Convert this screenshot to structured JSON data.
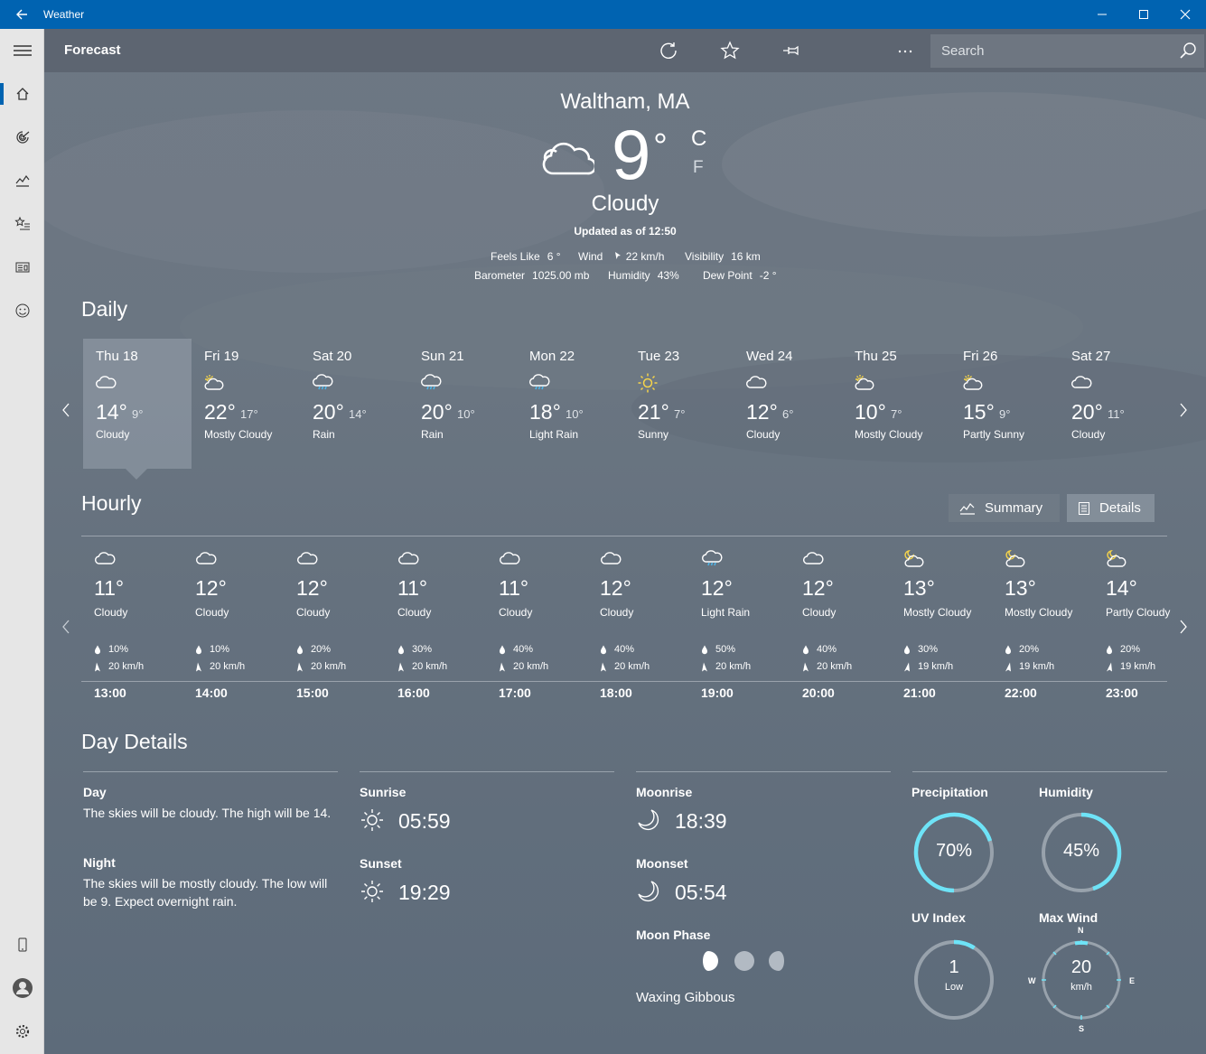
{
  "app": {
    "title": "Weather"
  },
  "header": {
    "title": "Forecast",
    "search_placeholder": "Search"
  },
  "current": {
    "location": "Waltham, MA",
    "temp": "9",
    "unit_c": "C",
    "unit_f": "F",
    "condition": "Cloudy",
    "updated": "Updated as of 12:50",
    "stats": {
      "feels_like_label": "Feels Like",
      "feels_like": "6 °",
      "wind_label": "Wind",
      "wind": "22 km/h",
      "visibility_label": "Visibility",
      "visibility": "16 km",
      "barometer_label": "Barometer",
      "barometer": "1025.00 mb",
      "humidity_label": "Humidity",
      "humidity": "43%",
      "dew_point_label": "Dew Point",
      "dew_point": "-2 °"
    }
  },
  "daily": {
    "title": "Daily",
    "days": [
      {
        "name": "Thu 18",
        "hi": "14°",
        "lo": "9°",
        "cond": "Cloudy",
        "icon": "cloud"
      },
      {
        "name": "Fri 19",
        "hi": "22°",
        "lo": "17°",
        "cond": "Mostly Cloudy",
        "icon": "sun-cloud"
      },
      {
        "name": "Sat 20",
        "hi": "20°",
        "lo": "14°",
        "cond": "Rain",
        "icon": "rain"
      },
      {
        "name": "Sun 21",
        "hi": "20°",
        "lo": "10°",
        "cond": "Rain",
        "icon": "rain"
      },
      {
        "name": "Mon 22",
        "hi": "18°",
        "lo": "10°",
        "cond": "Light Rain",
        "icon": "rain"
      },
      {
        "name": "Tue 23",
        "hi": "21°",
        "lo": "7°",
        "cond": "Sunny",
        "icon": "sun"
      },
      {
        "name": "Wed 24",
        "hi": "12°",
        "lo": "6°",
        "cond": "Cloudy",
        "icon": "cloud"
      },
      {
        "name": "Thu 25",
        "hi": "10°",
        "lo": "7°",
        "cond": "Mostly Cloudy",
        "icon": "sun-cloud"
      },
      {
        "name": "Fri 26",
        "hi": "15°",
        "lo": "9°",
        "cond": "Partly Sunny",
        "icon": "sun-cloud"
      },
      {
        "name": "Sat 27",
        "hi": "20°",
        "lo": "11°",
        "cond": "Cloudy",
        "icon": "cloud"
      }
    ]
  },
  "hourly": {
    "title": "Hourly",
    "summary_label": "Summary",
    "details_label": "Details",
    "hours": [
      {
        "time": "13:00",
        "temp": "11°",
        "cond": "Cloudy",
        "precip": "10%",
        "wind": "20 km/h",
        "icon": "cloud"
      },
      {
        "time": "14:00",
        "temp": "12°",
        "cond": "Cloudy",
        "precip": "10%",
        "wind": "20 km/h",
        "icon": "cloud"
      },
      {
        "time": "15:00",
        "temp": "12°",
        "cond": "Cloudy",
        "precip": "20%",
        "wind": "20 km/h",
        "icon": "cloud"
      },
      {
        "time": "16:00",
        "temp": "11°",
        "cond": "Cloudy",
        "precip": "30%",
        "wind": "20 km/h",
        "icon": "cloud"
      },
      {
        "time": "17:00",
        "temp": "11°",
        "cond": "Cloudy",
        "precip": "40%",
        "wind": "20 km/h",
        "icon": "cloud"
      },
      {
        "time": "18:00",
        "temp": "12°",
        "cond": "Cloudy",
        "precip": "40%",
        "wind": "20 km/h",
        "icon": "cloud"
      },
      {
        "time": "19:00",
        "temp": "12°",
        "cond": "Light Rain",
        "precip": "50%",
        "wind": "20 km/h",
        "icon": "rain"
      },
      {
        "time": "20:00",
        "temp": "12°",
        "cond": "Cloudy",
        "precip": "40%",
        "wind": "20 km/h",
        "icon": "cloud"
      },
      {
        "time": "21:00",
        "temp": "13°",
        "cond": "Mostly Cloudy",
        "precip": "30%",
        "wind": "19 km/h",
        "icon": "moon-cloud"
      },
      {
        "time": "22:00",
        "temp": "13°",
        "cond": "Mostly Cloudy",
        "precip": "20%",
        "wind": "19 km/h",
        "icon": "moon-cloud"
      },
      {
        "time": "23:00",
        "temp": "14°",
        "cond": "Partly Cloudy",
        "precip": "20%",
        "wind": "19 km/h",
        "icon": "moon-cloud"
      }
    ]
  },
  "details": {
    "title": "Day Details",
    "day_label": "Day",
    "day_text": "The skies will be cloudy. The high will be 14.",
    "night_label": "Night",
    "night_text": "The skies will be mostly cloudy. The low will be 9. Expect overnight rain.",
    "sunrise_label": "Sunrise",
    "sunrise": "05:59",
    "sunset_label": "Sunset",
    "sunset": "19:29",
    "moonrise_label": "Moonrise",
    "moonrise": "18:39",
    "moonset_label": "Moonset",
    "moonset": "05:54",
    "moon_phase_label": "Moon Phase",
    "moon_phase": "Waxing Gibbous",
    "precip_label": "Precipitation",
    "precip_value": "70%",
    "precip_fraction": 0.7,
    "humidity_label": "Humidity",
    "humidity_value": "45%",
    "humidity_fraction": 0.45,
    "uv_label": "UV Index",
    "uv_value": "1",
    "uv_desc": "Low",
    "uv_fraction": 0.09,
    "wind_label": "Max Wind",
    "wind_value": "20",
    "wind_unit": "km/h",
    "compass": {
      "n": "N",
      "e": "E",
      "s": "S",
      "w": "W"
    }
  },
  "colors": {
    "accent": "#0063b1",
    "gauge": "#6ee3f7",
    "track": "#98a2ac",
    "sun": "#f6d44a",
    "rain": "#4fb4e6"
  }
}
